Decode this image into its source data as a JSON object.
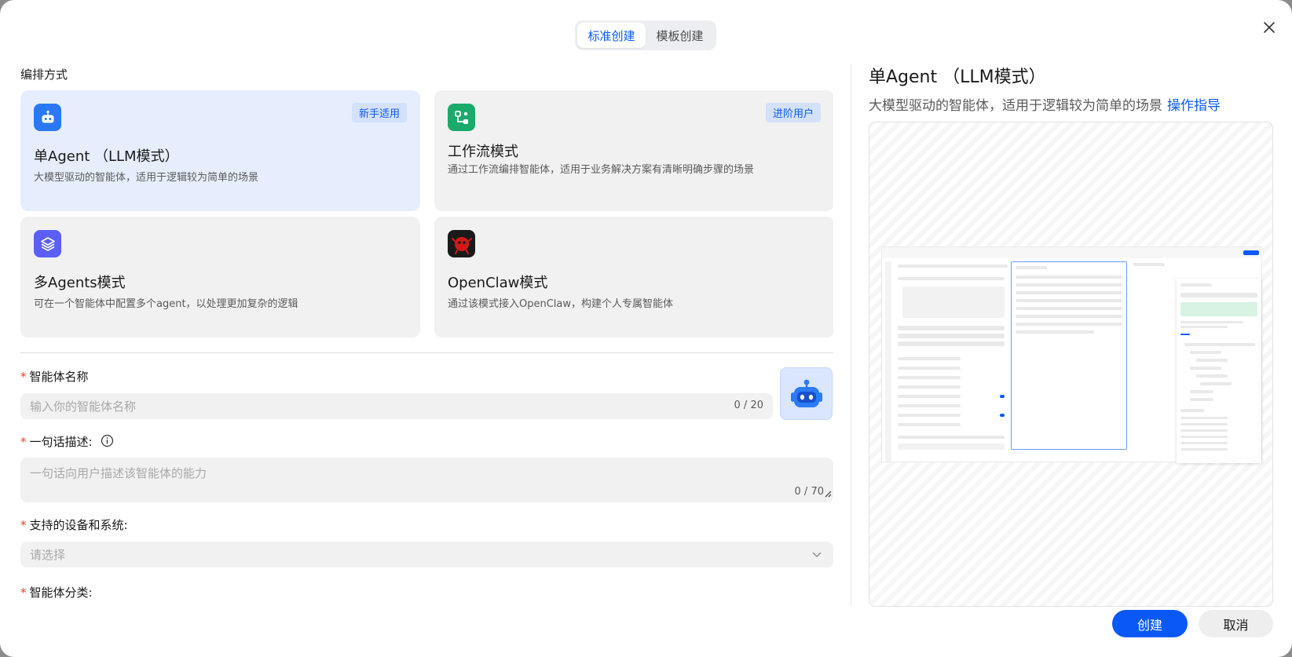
{
  "tabs": [
    {
      "label": "标准创建",
      "active": true
    },
    {
      "label": "模板创建",
      "active": false
    }
  ],
  "section_title": "编排方式",
  "cards": [
    {
      "title": "单Agent （LLM模式）",
      "desc": "大模型驱动的智能体，适用于逻辑较为简单的场景",
      "badge": "新手适用",
      "icon": "robot-icon",
      "selected": true
    },
    {
      "title": "工作流模式",
      "desc": "通过工作流编排智能体，适用于业务解决方案有清晰明确步骤的场景",
      "badge": "进阶用户",
      "icon": "workflow-icon",
      "selected": false
    },
    {
      "title": "多Agents模式",
      "desc": "可在一个智能体中配置多个agent，以处理更加复杂的逻辑",
      "badge": "",
      "icon": "layers-icon",
      "selected": false
    },
    {
      "title": "OpenClaw模式",
      "desc": "通过该模式接入OpenClaw，构建个人专属智能体",
      "badge": "",
      "icon": "openclaw-icon",
      "selected": false
    }
  ],
  "form": {
    "name_label": "智能体名称",
    "name_placeholder": "输入你的智能体名称",
    "name_counter": "0 / 20",
    "desc_label": "一句话描述:",
    "desc_placeholder": "一句话向用户描述该智能体的能力",
    "desc_counter": "0 / 70",
    "devices_label": "支持的设备和系统:",
    "devices_placeholder": "请选择",
    "category_label": "智能体分类:",
    "required_mark": "*"
  },
  "preview": {
    "title": "单Agent （LLM模式）",
    "desc": "大模型驱动的智能体，适用于逻辑较为简单的场景",
    "link": "操作指导"
  },
  "buttons": {
    "create": "创建",
    "cancel": "取消"
  },
  "colors": {
    "accent": "#0a59f7",
    "selected_card": "#e6eefe",
    "card_bg": "#f1f1f1",
    "workflow_icon": "#1aaa6b",
    "layers_icon": "#5b5ff5",
    "openclaw_icon": "#c01818"
  }
}
